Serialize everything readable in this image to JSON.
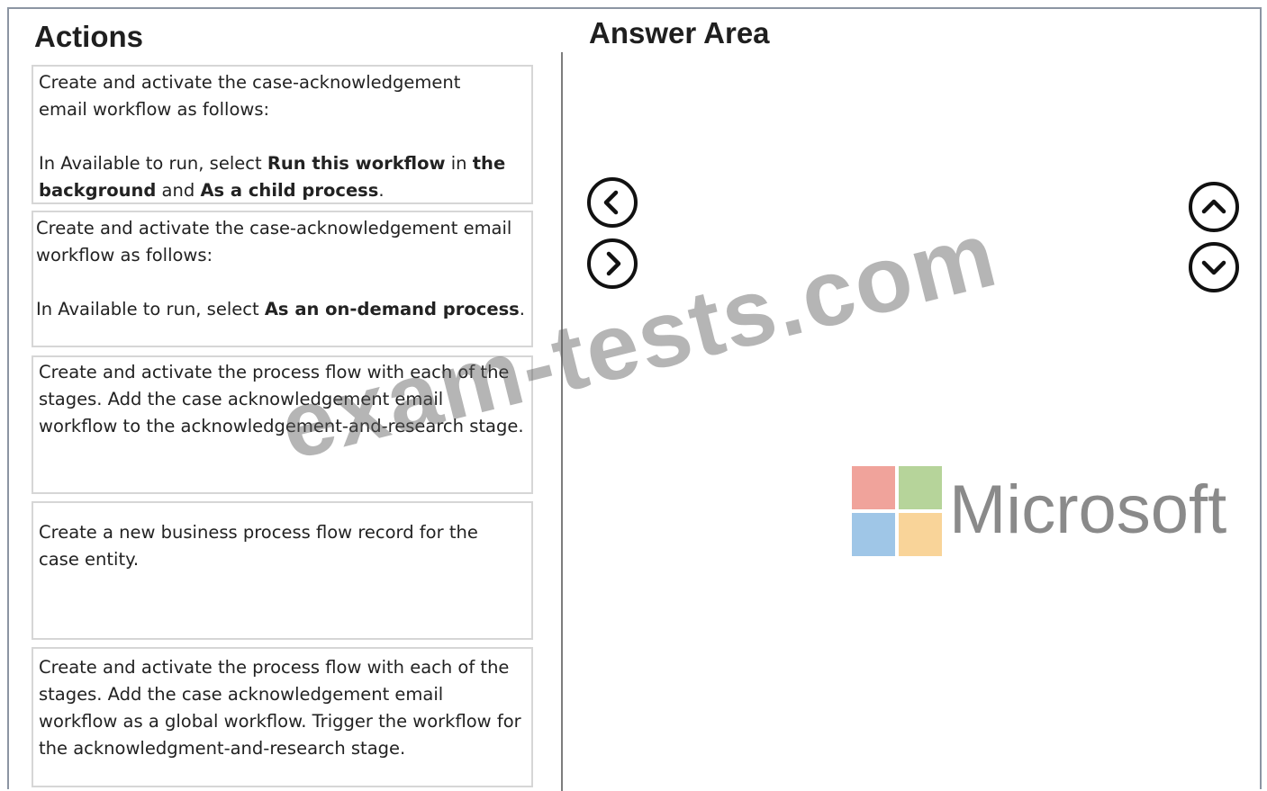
{
  "actions": {
    "title": "Actions",
    "items": [
      {
        "line1": "Create and activate the case-acknowledgement email workflow as follows:",
        "p2_prefix": "In Available to run, select ",
        "p2_bold1": "Run this workflow",
        "p2_mid": " in ",
        "p2_bold2": "the background",
        "p2_and": " and ",
        "p2_bold3": "As a child process",
        "p2_end": "."
      },
      {
        "line1": "Create and activate the case-acknowledgement email workflow as follows:",
        "p2_prefix": "In Available to run, select ",
        "p2_bold1": "As an on-demand process",
        "p2_end": "."
      },
      {
        "text": "Create and activate the process flow with each of the stages. Add the case acknowledgement email workflow to the acknowledgement-and-research stage."
      },
      {
        "text": "Create a new business process flow record for the case entity."
      },
      {
        "text": "Create and activate the process flow with each of the stages. Add the case acknowledgement email workflow as a global workflow. Trigger the workflow for the acknowledgment-and-research stage."
      }
    ]
  },
  "answer_area": {
    "title": "Answer Area"
  },
  "controls": {
    "move_left_icon": "chevron-left-circle-icon",
    "move_right_icon": "chevron-right-circle-icon",
    "move_up_icon": "chevron-up-circle-icon",
    "move_down_icon": "chevron-down-circle-icon"
  },
  "branding": {
    "logo_word": "Microsoft",
    "colors": {
      "red": "#f0a39b",
      "green": "#b6d49a",
      "blue": "#9fc6e7",
      "yellow": "#f9d499"
    }
  },
  "watermark": "exam-tests.com"
}
